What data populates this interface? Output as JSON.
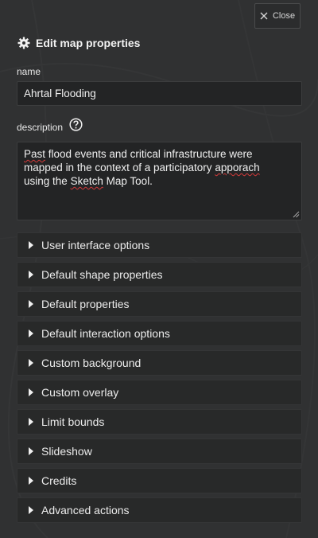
{
  "close_button": {
    "label": "Close",
    "icon": "close-icon"
  },
  "header": {
    "title": "Edit map properties",
    "icon": "gear-icon"
  },
  "name_field": {
    "label": "name",
    "value": "Ahrtal Flooding"
  },
  "description_field": {
    "label": "description",
    "help_icon": "question-circle-icon",
    "lines": [
      [
        "Past flood events and critical infrastructure were"
      ],
      [
        "mapped in the context of a participatory ",
        {
          "t": "apporach",
          "err": true
        }
      ],
      [
        "using the Sketch Map Tool."
      ]
    ]
  },
  "sections": [
    {
      "label": "User interface options"
    },
    {
      "label": "Default shape properties"
    },
    {
      "label": "Default properties"
    },
    {
      "label": "Default interaction options"
    },
    {
      "label": "Custom background"
    },
    {
      "label": "Custom overlay"
    },
    {
      "label": "Limit bounds"
    },
    {
      "label": "Slideshow"
    },
    {
      "label": "Credits"
    },
    {
      "label": "Advanced actions"
    }
  ],
  "colors": {
    "panel_bg": "#303132",
    "input_bg": "#232425",
    "section_bg": "#282929",
    "text": "#eeeeee",
    "spellcheck": "#d43a3a"
  }
}
